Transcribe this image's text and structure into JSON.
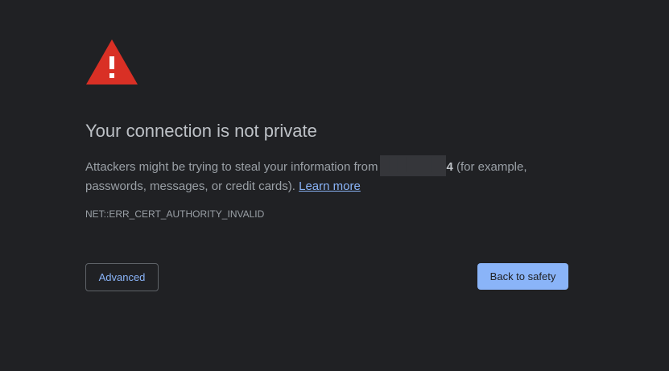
{
  "page": {
    "icon": "warning-triangle-icon",
    "title": "Your connection is not private",
    "message_prefix": "Attackers might be trying to steal your information from",
    "host_redacted": "████████",
    "host_suffix": "4",
    "message_suffix": " (for example, passwords, messages, or credit cards).",
    "learn_more": "Learn more",
    "error_code": "NET::ERR_CERT_AUTHORITY_INVALID"
  },
  "buttons": {
    "advanced": "Advanced",
    "back_to_safety": "Back to safety"
  },
  "colors": {
    "background": "#202124",
    "warning_red": "#d93025",
    "accent_blue": "#8ab4f8",
    "heading": "#bdc1c6",
    "body_text": "#9aa0a6",
    "redaction": "#35363a"
  }
}
